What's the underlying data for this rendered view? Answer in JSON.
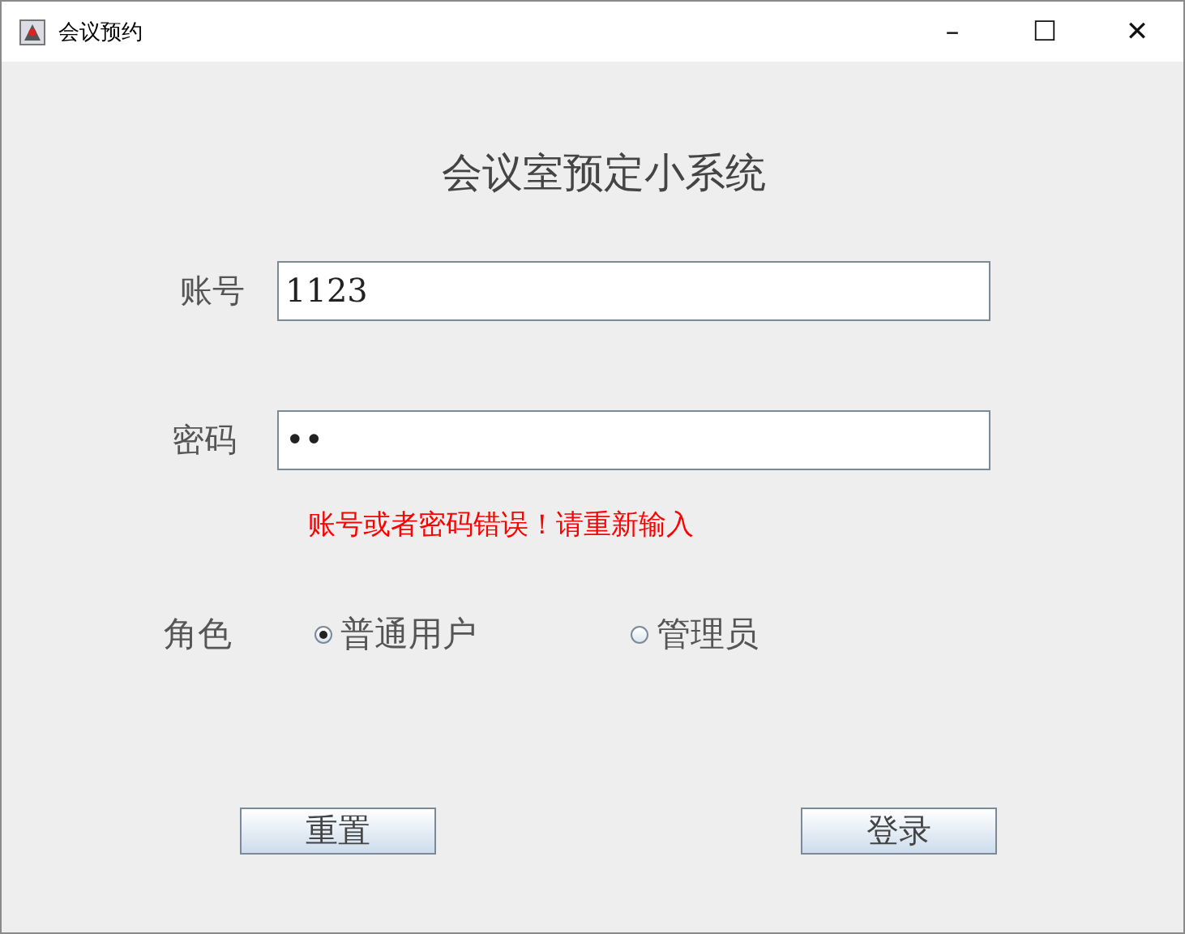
{
  "window": {
    "title": "会议预约",
    "controls": [
      "–",
      "☐",
      "✕"
    ]
  },
  "heading": "会议室预定小系统",
  "fields": [
    {
      "label": "账号",
      "value": "1123"
    },
    {
      "label": "密码",
      "value": "••"
    }
  ],
  "error": "账号或者密码错误！请重新输入",
  "role": {
    "label": "角色",
    "options": [
      {
        "label": "普通用户",
        "selected": true
      },
      {
        "label": "管理员",
        "selected": false
      }
    ]
  },
  "buttons": [
    "重置",
    "登录"
  ]
}
